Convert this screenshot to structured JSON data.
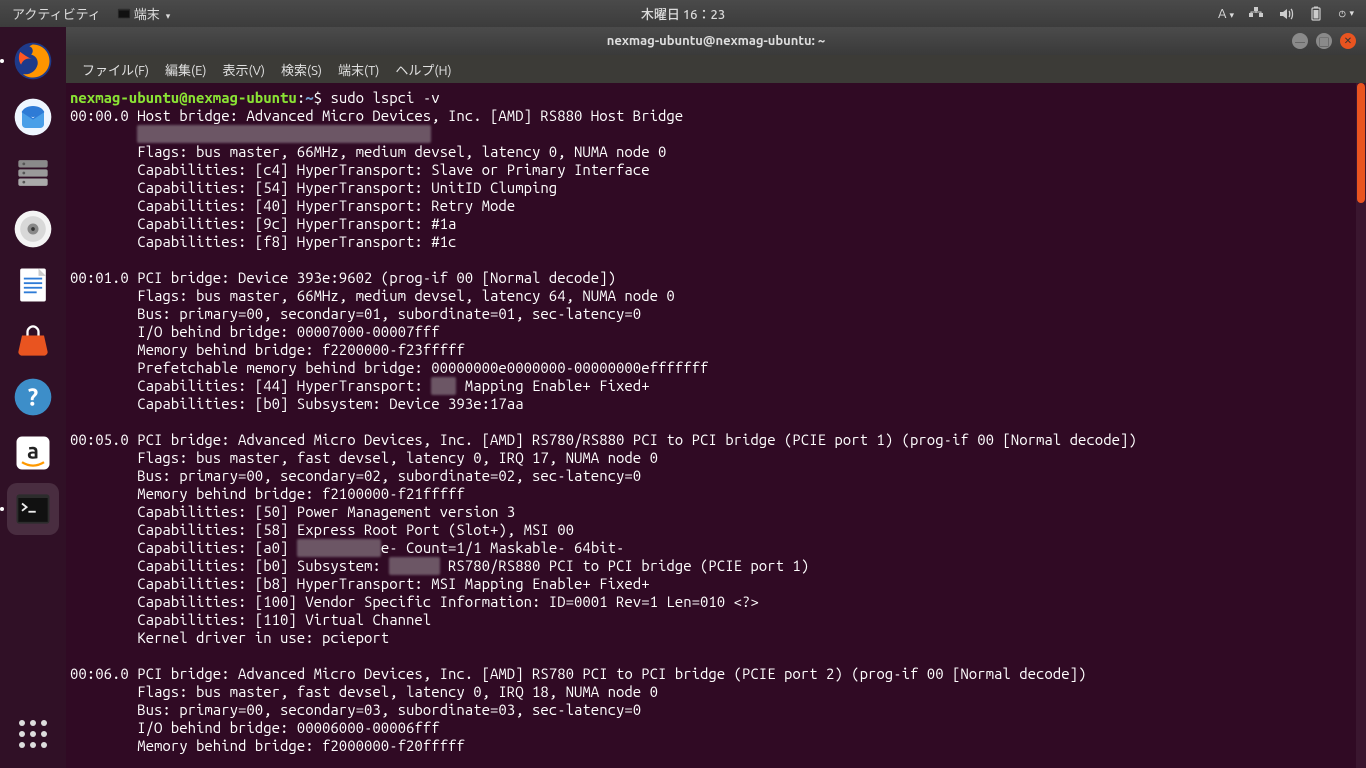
{
  "topbar": {
    "activities": "アクティビティ",
    "app_menu": "端末",
    "clock": "木曜日 16：23",
    "lang_indicator": "A"
  },
  "launcher": {
    "items": [
      {
        "name": "firefox",
        "active": true
      },
      {
        "name": "thunderbird",
        "active": false
      },
      {
        "name": "files",
        "active": false
      },
      {
        "name": "rhythmbox",
        "active": false
      },
      {
        "name": "libreoffice-writer",
        "active": false
      },
      {
        "name": "ubuntu-software",
        "active": false
      },
      {
        "name": "help",
        "active": false
      },
      {
        "name": "amazon",
        "active": false
      },
      {
        "name": "terminal",
        "active": true
      }
    ]
  },
  "window": {
    "title": "nexmag-ubuntu@nexmag-ubuntu: ~"
  },
  "menubar": {
    "file": "ファイル(F)",
    "edit": "編集(E)",
    "view": "表示(V)",
    "search": "検索(S)",
    "terminal": "端末(T)",
    "help": "ヘルプ(H)"
  },
  "prompt": {
    "user_host": "nexmag-ubuntu@nexmag-ubuntu",
    "path": "~",
    "command": "sudo lspci -v"
  },
  "output": [
    "00:00.0 Host bridge: Advanced Micro Devices, Inc. [AMD] RS880 Host Bridge",
    {
      "indent": 8,
      "blur": true,
      "text": "Subsystem: Lenovo RS880 Host Bridge"
    },
    {
      "indent": 8,
      "text": "Flags: bus master, 66MHz, medium devsel, latency 0, NUMA node 0"
    },
    {
      "indent": 8,
      "text": "Capabilities: [c4] HyperTransport: Slave or Primary Interface"
    },
    {
      "indent": 8,
      "text": "Capabilities: [54] HyperTransport: UnitID Clumping"
    },
    {
      "indent": 8,
      "text": "Capabilities: [40] HyperTransport: Retry Mode"
    },
    {
      "indent": 8,
      "text": "Capabilities: [9c] HyperTransport: #1a"
    },
    {
      "indent": 8,
      "text": "Capabilities: [f8] HyperTransport: #1c"
    },
    {
      "text": ""
    },
    "00:01.0 PCI bridge: Device 393e:9602 (prog-if 00 [Normal decode])",
    {
      "indent": 8,
      "text": "Flags: bus master, 66MHz, medium devsel, latency 64, NUMA node 0"
    },
    {
      "indent": 8,
      "text": "Bus: primary=00, secondary=01, subordinate=01, sec-latency=0"
    },
    {
      "indent": 8,
      "text": "I/O behind bridge: 00007000-00007fff"
    },
    {
      "indent": 8,
      "text": "Memory behind bridge: f2200000-f23fffff"
    },
    {
      "indent": 8,
      "text": "Prefetchable memory behind bridge: 00000000e0000000-00000000efffffff"
    },
    {
      "indent": 8,
      "text": "Capabilities: [44] HyperTransport: ",
      "blur_mid": "MSI",
      "tail": " Mapping Enable+ Fixed+"
    },
    {
      "indent": 8,
      "text": "Capabilities: [b0] Subsystem: Device 393e:17aa"
    },
    {
      "text": ""
    },
    "00:05.0 PCI bridge: Advanced Micro Devices, Inc. [AMD] RS780/RS880 PCI to PCI bridge (PCIE port 1) (prog-if 00 [Normal decode])",
    {
      "indent": 8,
      "text": "Flags: bus master, fast devsel, latency 0, IRQ 17, NUMA node 0"
    },
    {
      "indent": 8,
      "text": "Bus: primary=00, secondary=02, subordinate=02, sec-latency=0"
    },
    {
      "indent": 8,
      "text": "Memory behind bridge: f2100000-f21fffff"
    },
    {
      "indent": 8,
      "text": "Capabilities: [50] Power Management version 3"
    },
    {
      "indent": 8,
      "text": "Capabilities: [58] Express Root Port (Slot+), MSI 00"
    },
    {
      "indent": 8,
      "text": "Capabilities: [a0] ",
      "blur_mid": "MSI: Enabl",
      "tail": "e- Count=1/1 Maskable- 64bit-"
    },
    {
      "indent": 8,
      "text": "Capabilities: [b0] Subsystem: ",
      "blur_mid": "Lenovo",
      "tail": " RS780/RS880 PCI to PCI bridge (PCIE port 1)"
    },
    {
      "indent": 8,
      "text": "Capabilities: [b8] HyperTransport: MSI Mapping Enable+ Fixed+"
    },
    {
      "indent": 8,
      "text": "Capabilities: [100] Vendor Specific Information: ID=0001 Rev=1 Len=010 <?>"
    },
    {
      "indent": 8,
      "text": "Capabilities: [110] Virtual Channel"
    },
    {
      "indent": 8,
      "text": "Kernel driver in use: pcieport"
    },
    {
      "text": ""
    },
    "00:06.0 PCI bridge: Advanced Micro Devices, Inc. [AMD] RS780 PCI to PCI bridge (PCIE port 2) (prog-if 00 [Normal decode])",
    {
      "indent": 8,
      "text": "Flags: bus master, fast devsel, latency 0, IRQ 18, NUMA node 0"
    },
    {
      "indent": 8,
      "text": "Bus: primary=00, secondary=03, subordinate=03, sec-latency=0"
    },
    {
      "indent": 8,
      "text": "I/O behind bridge: 00006000-00006fff"
    },
    {
      "indent": 8,
      "text": "Memory behind bridge: f2000000-f20fffff"
    }
  ]
}
